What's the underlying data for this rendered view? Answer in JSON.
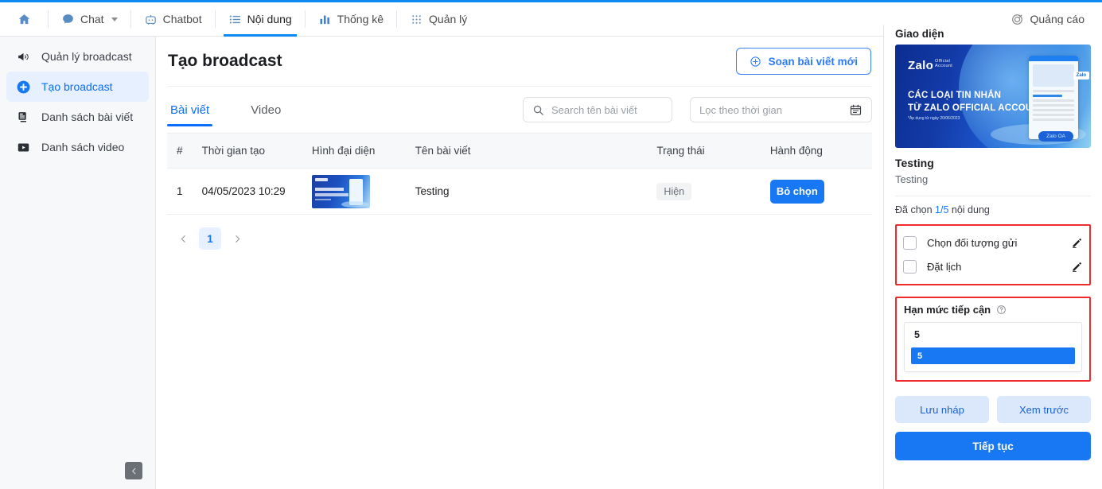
{
  "topnav": {
    "home_icon": "home-icon",
    "items": [
      {
        "label": "Chat",
        "icon": "chat-bubble-icon",
        "has_caret": true,
        "active": false
      },
      {
        "label": "Chatbot",
        "icon": "robot-icon",
        "has_caret": false,
        "active": false
      },
      {
        "label": "Nội dung",
        "icon": "list-icon",
        "has_caret": false,
        "active": true
      },
      {
        "label": "Thống kê",
        "icon": "bar-chart-icon",
        "has_caret": false,
        "active": false
      },
      {
        "label": "Quản lý",
        "icon": "grid-dots-icon",
        "has_caret": false,
        "active": false
      }
    ],
    "right": {
      "label": "Quảng cáo",
      "icon": "target-icon"
    }
  },
  "sidebar": {
    "items": [
      {
        "label": "Quản lý broadcast",
        "icon": "megaphone-icon",
        "active": false
      },
      {
        "label": "Tạo broadcast",
        "icon": "plus-circle-icon",
        "active": true
      },
      {
        "label": "Danh sách bài viết",
        "icon": "article-list-icon",
        "active": false
      },
      {
        "label": "Danh sách video",
        "icon": "video-play-icon",
        "active": false
      }
    ],
    "collapse_icon": "chevron-left-icon"
  },
  "main": {
    "page_title": "Tạo broadcast",
    "compose_button": {
      "label": "Soạn bài viết mới",
      "icon": "plus-circle-outline-icon"
    },
    "tabs": [
      {
        "label": "Bài viết",
        "active": true
      },
      {
        "label": "Video",
        "active": false
      }
    ],
    "search": {
      "placeholder": "Search tên bài viết",
      "value": "",
      "icon": "search-icon"
    },
    "date_filter": {
      "placeholder": "Lọc theo thời gian",
      "value": "",
      "icon": "calendar-icon"
    },
    "table": {
      "columns": [
        "#",
        "Thời gian tạo",
        "Hình đại diện",
        "Tên bài viết",
        "Trạng thái",
        "Hành động"
      ],
      "rows": [
        {
          "index": "1",
          "created_at": "04/05/2023 10:29",
          "thumbnail": "zalo-banner-thumbnail",
          "name": "Testing",
          "status": "Hiện",
          "action": "Bỏ chọn"
        }
      ]
    },
    "pagination": {
      "prev_icon": "chevron-left-icon",
      "next_icon": "chevron-right-icon",
      "current_page": "1"
    }
  },
  "right_panel": {
    "section_title": "Giao diện",
    "banner": {
      "brand": "Zalo",
      "brand_sub_line1": "Official",
      "brand_sub_line2": "Account",
      "headline_line1": "CÁC LOẠI TIN NHẮN",
      "headline_line2": "TỪ ZALO OFFICIAL ACCOUNT",
      "note": "*Áp dụng từ ngày 20/06/2023",
      "bubble_label": "Zalo",
      "pill_label": "Zalo OA"
    },
    "post_title": "Testing",
    "post_subtitle": "Testing",
    "selected_count_prefix": "Đã chọn ",
    "selected_count_value": "1/5",
    "selected_count_suffix": " nội dung",
    "options": [
      {
        "label": "Chọn đối tượng gửi",
        "checked": false,
        "edit_icon": "pencil-icon"
      },
      {
        "label": "Đặt lịch",
        "checked": false,
        "edit_icon": "pencil-icon"
      }
    ],
    "limit": {
      "title": "Hạn mức tiếp cận",
      "help_icon": "question-circle-icon",
      "current_value": "5",
      "highlighted_option": "5"
    },
    "buttons": {
      "save_draft": "Lưu nháp",
      "preview": "Xem trước",
      "continue": "Tiếp tục"
    }
  },
  "colors": {
    "accent_blue": "#1877f2",
    "link_blue": "#0d6efd",
    "highlight_red": "#f02b2b",
    "ghost_blue_bg": "#dbe7fb",
    "sidebar_bg": "#f7f8fa"
  }
}
